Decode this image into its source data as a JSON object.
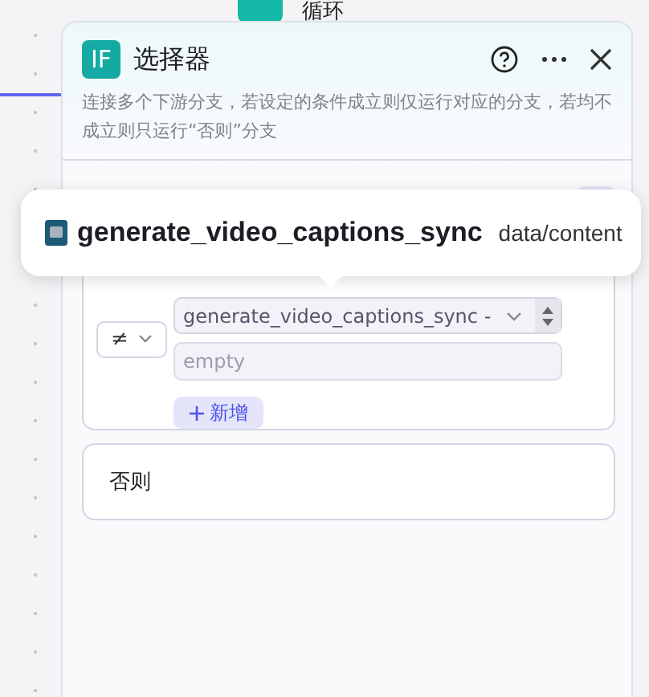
{
  "canvas": {
    "node_title": "循环"
  },
  "panel": {
    "logo": "IF",
    "title": "选择器",
    "description": "连接多个下游分支，若设定的条件成立则仅运行对应的分支，若均不成立则只运行“否则”分支"
  },
  "tooltip": {
    "name": "generate_video_captions_sync",
    "path": "data/content"
  },
  "condition": {
    "operator": "≠",
    "variable": "generate_video_captions_sync -",
    "value_placeholder": "empty",
    "add_label": "新增"
  },
  "else_branch": {
    "label": "否则"
  }
}
